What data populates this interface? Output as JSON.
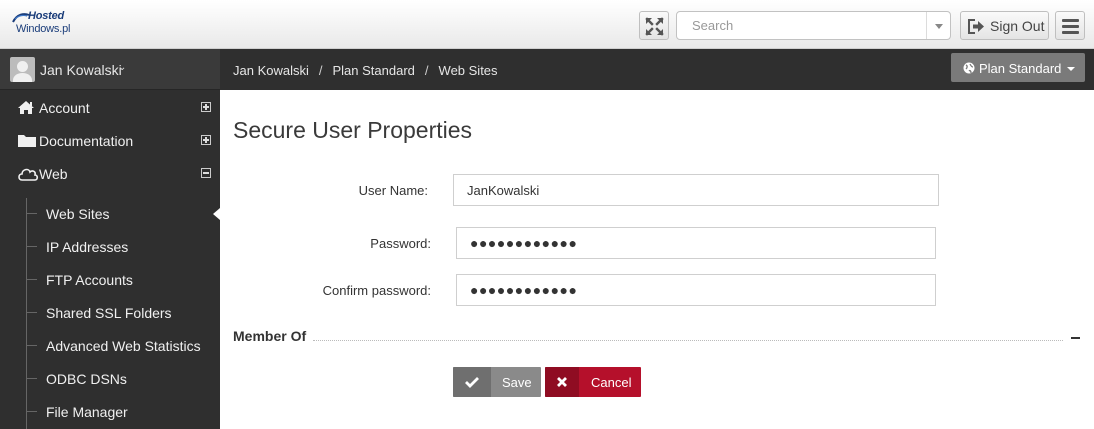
{
  "header": {
    "logo": {
      "line1": "Hosted",
      "line2": "Windows.pl"
    },
    "search_placeholder": "Search",
    "sign_out_label": "Sign Out",
    "icons": {
      "fullscreen": "fullscreen-icon",
      "signout": "sign-out-icon",
      "menu": "hamburger-icon"
    }
  },
  "sidebar": {
    "user": {
      "name": "Jan Kowalski",
      "chevron": "⌄"
    },
    "items": [
      {
        "label": "Account",
        "icon": "home-icon",
        "state": "collapsed"
      },
      {
        "label": "Documentation",
        "icon": "folder-icon",
        "state": "collapsed"
      },
      {
        "label": "Web",
        "icon": "cloud-icon",
        "state": "expanded"
      }
    ],
    "web_subitems": [
      {
        "label": "Web Sites",
        "active": true
      },
      {
        "label": "IP Addresses"
      },
      {
        "label": "FTP Accounts"
      },
      {
        "label": "Shared SSL Folders"
      },
      {
        "label": "Advanced Web Statistics"
      },
      {
        "label": "ODBC DSNs"
      },
      {
        "label": "File Manager"
      }
    ]
  },
  "breadcrumb": {
    "items": [
      "Jan Kowalski",
      "Plan Standard",
      "Web Sites"
    ],
    "separator": "/",
    "plan_button": "Plan Standard"
  },
  "main": {
    "title": "Secure User Properties",
    "fields": {
      "username": {
        "label": "User Name:",
        "value": "JanKowalski"
      },
      "password": {
        "label": "Password:",
        "value": "●●●●●●●●●●●●"
      },
      "confirm": {
        "label": "Confirm password:",
        "value": "●●●●●●●●●●●●"
      }
    },
    "section_member_of": "Member Of",
    "save_label": "Save",
    "cancel_label": "Cancel"
  },
  "colors": {
    "sidebar_bg": "#2f2f2f",
    "cancel": "#b5102b",
    "save": "#8a8a8a"
  }
}
